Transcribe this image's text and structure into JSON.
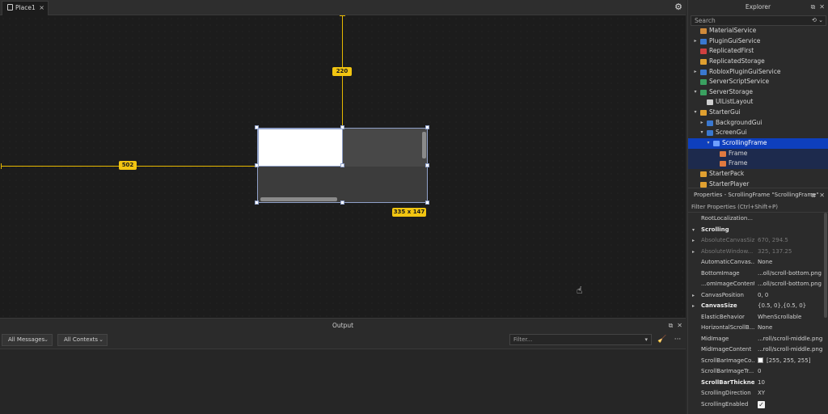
{
  "viewport": {
    "tab_label": "Place1",
    "tab_close": "×",
    "settings_icon": "gear-icon",
    "measure_horizontal": "502",
    "measure_vertical": "220",
    "size_label": "335 x 147"
  },
  "output": {
    "title": "Output",
    "messages_dropdown": "All Messages",
    "contexts_dropdown": "All Contexts",
    "filter_placeholder": "Filter...",
    "more": "···"
  },
  "explorer": {
    "title": "Explorer",
    "search_placeholder": "Search",
    "items": [
      {
        "label": "MaterialService",
        "depth": 0,
        "arrow": "",
        "icon_color": "#d08a3a"
      },
      {
        "label": "PluginGuiService",
        "depth": 0,
        "arrow": "▸",
        "icon_color": "#3a78d0"
      },
      {
        "label": "ReplicatedFirst",
        "depth": 0,
        "arrow": "",
        "icon_color": "#d04040"
      },
      {
        "label": "ReplicatedStorage",
        "depth": 0,
        "arrow": "",
        "icon_color": "#e0a030"
      },
      {
        "label": "RobloxPluginGuiService",
        "depth": 0,
        "arrow": "▸",
        "icon_color": "#3a78d0"
      },
      {
        "label": "ServerScriptService",
        "depth": 0,
        "arrow": "",
        "icon_color": "#3aa060"
      },
      {
        "label": "ServerStorage",
        "depth": 0,
        "arrow": "▾",
        "icon_color": "#3aa060"
      },
      {
        "label": "UIListLayout",
        "depth": 1,
        "arrow": "",
        "icon_color": "#cfcfcf"
      },
      {
        "label": "StarterGui",
        "depth": 0,
        "arrow": "▾",
        "icon_color": "#e0a030"
      },
      {
        "label": "BackgroundGui",
        "depth": 1,
        "arrow": "▸",
        "icon_color": "#3a78d0"
      },
      {
        "label": "ScreenGui",
        "depth": 1,
        "arrow": "▾",
        "icon_color": "#3a78d0"
      },
      {
        "label": "ScrollingFrame",
        "depth": 2,
        "arrow": "▾",
        "icon_color": "#6fa0ff",
        "selected": true
      },
      {
        "label": "Frame",
        "depth": 3,
        "arrow": "",
        "icon_color": "#e07a40",
        "subsel": true
      },
      {
        "label": "Frame",
        "depth": 3,
        "arrow": "",
        "icon_color": "#e07a40",
        "subsel": true
      },
      {
        "label": "StarterPack",
        "depth": 0,
        "arrow": "",
        "icon_color": "#e0a030"
      },
      {
        "label": "StarterPlayer",
        "depth": 0,
        "arrow": "",
        "icon_color": "#e0a030"
      }
    ]
  },
  "properties": {
    "title": "Properties - ScrollingFrame \"ScrollingFrame\"",
    "filter_placeholder": "Filter Properties (Ctrl+Shift+P)",
    "rows": [
      {
        "name": "RootLocalization...",
        "value": "",
        "style": ""
      },
      {
        "name": "Scrolling",
        "value": "",
        "style": "section",
        "arrow": "▾"
      },
      {
        "name": "AbsoluteCanvasSize",
        "value": "670, 294.5",
        "style": "dim",
        "arrow": "▸"
      },
      {
        "name": "AbsoluteWindow...",
        "value": "325, 137.25",
        "style": "dim",
        "arrow": "▸"
      },
      {
        "name": "AutomaticCanvas...",
        "value": "None",
        "style": ""
      },
      {
        "name": "BottomImage",
        "value": "...oll/scroll-bottom.png",
        "style": ""
      },
      {
        "name": "...omImageContent",
        "value": "...oll/scroll-bottom.png",
        "style": ""
      },
      {
        "name": "CanvasPosition",
        "value": "0, 0",
        "style": "",
        "arrow": "▸"
      },
      {
        "name": "CanvasSize",
        "value": "{0.5, 0},{0.5, 0}",
        "style": "bold",
        "arrow": "▸"
      },
      {
        "name": "ElasticBehavior",
        "value": "WhenScrollable",
        "style": ""
      },
      {
        "name": "HorizontalScrollB...",
        "value": "None",
        "style": ""
      },
      {
        "name": "MidImage",
        "value": "...roll/scroll-middle.png",
        "style": ""
      },
      {
        "name": "MidImageContent",
        "value": "...roll/scroll-middle.png",
        "style": ""
      },
      {
        "name": "ScrollBarImageCo...",
        "value": "[255, 255, 255]",
        "style": "",
        "swatch": true
      },
      {
        "name": "ScrollBarImageTr...",
        "value": "0",
        "style": ""
      },
      {
        "name": "ScrollBarThickness",
        "value": "10",
        "style": "bold"
      },
      {
        "name": "ScrollingDirection",
        "value": "XY",
        "style": ""
      },
      {
        "name": "ScrollingEnabled",
        "value": "",
        "style": "",
        "checkbox": true
      }
    ]
  }
}
